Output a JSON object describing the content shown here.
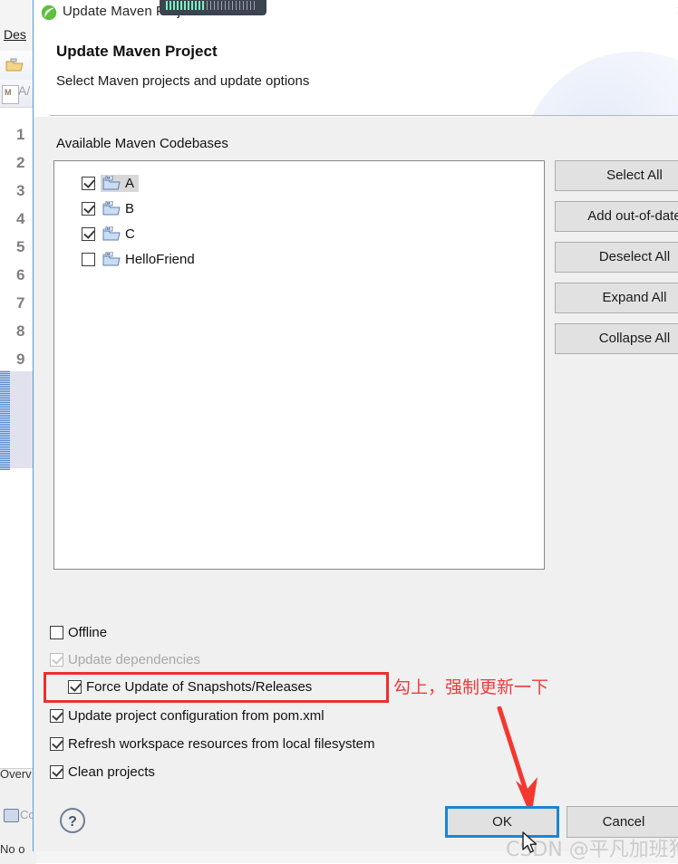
{
  "background_ide": {
    "menu_label": "Des",
    "tab_label": "A/",
    "line_numbers": [
      "1",
      "2",
      "3",
      "4",
      "5",
      "6",
      "7",
      "8",
      "9"
    ],
    "first_line_suffix": "9",
    "bottom_tab_label": "Overv",
    "console_label": "Co",
    "status_text": "No o",
    "folder_icon": "open-folder-icon",
    "editor_tab_icon": "maven-file-icon",
    "console_icon": "console-icon"
  },
  "dialog": {
    "window_title": "Update Maven Project",
    "window_icon": "maven-leaf-icon",
    "close_icon": "✕",
    "title": "Update Maven Project",
    "subtitle": "Select Maven projects and update options",
    "list_label": "Available Maven Codebases",
    "tree_items": [
      {
        "name": "A",
        "checked": true,
        "selected": true,
        "icon": "maven-project-folder-icon"
      },
      {
        "name": "B",
        "checked": true,
        "selected": false,
        "icon": "maven-project-folder-icon"
      },
      {
        "name": "C",
        "checked": true,
        "selected": false,
        "icon": "maven-project-folder-icon"
      },
      {
        "name": "HelloFriend",
        "checked": false,
        "selected": false,
        "icon": "maven-project-folder-icon"
      }
    ],
    "side_buttons": [
      {
        "label": "Select All"
      },
      {
        "label": "Add out-of-date"
      },
      {
        "label": "Deselect All"
      },
      {
        "label": "Expand All"
      },
      {
        "label": "Collapse All"
      }
    ],
    "options": [
      {
        "label": "Offline",
        "checked": false,
        "disabled": false,
        "indent": 0
      },
      {
        "label": "Update dependencies",
        "checked": true,
        "disabled": true,
        "indent": 0
      },
      {
        "label": "Force Update of Snapshots/Releases",
        "checked": true,
        "disabled": false,
        "indent": 1
      },
      {
        "label": "Update project configuration from pom.xml",
        "checked": true,
        "disabled": false,
        "indent": 0
      },
      {
        "label": "Refresh workspace resources from local filesystem",
        "checked": true,
        "disabled": false,
        "indent": 0
      },
      {
        "label": "Clean projects",
        "checked": true,
        "disabled": false,
        "indent": 0
      }
    ],
    "help_icon": "question-mark-help-icon",
    "ok_label": "OK",
    "cancel_label": "Cancel"
  },
  "annotation": {
    "text": "勾上，强制更新一下",
    "color": "#f03a3a",
    "arrow_icon": "red-down-arrow-icon",
    "highlight_color": "#ef2e2e",
    "highlight_target": "Force Update of Snapshots/Releases"
  },
  "watermark": {
    "main": "CSDN @平凡加班狗",
    "bottom": "CSDN @平凡加班狗"
  },
  "colors": {
    "dialog_border": "#4f9bd9",
    "dialog_body": "#f0f0f0",
    "header_bg": "#ffffff",
    "button_face": "#e1e1e1",
    "default_focus": "#1a84d6",
    "annotation_red": "#ef2e2e"
  }
}
